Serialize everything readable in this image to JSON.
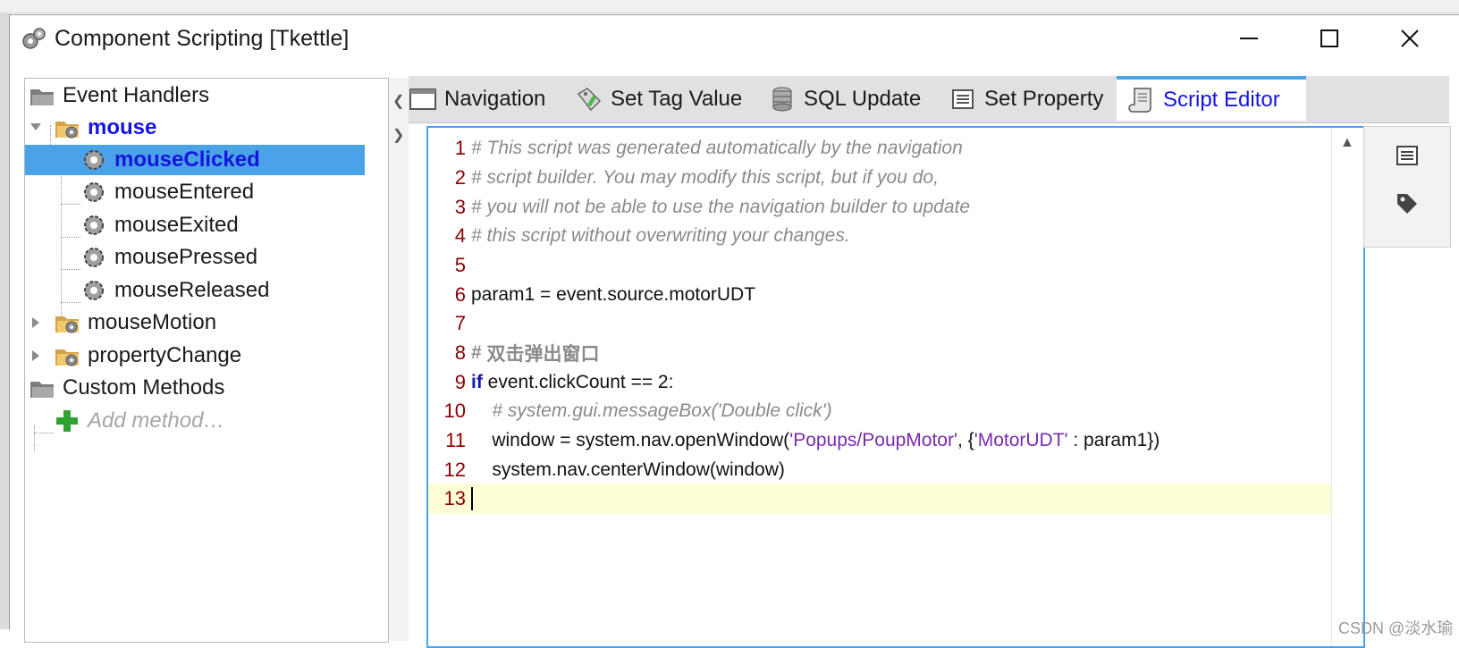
{
  "window": {
    "title": "Component Scripting [Tkettle]",
    "icons": [
      "gears-icon",
      "minimize-icon",
      "maximize-icon",
      "close-icon"
    ]
  },
  "tree": {
    "event_handlers": "Event Handlers",
    "mouse": "mouse",
    "items": [
      "mouseClicked",
      "mouseEntered",
      "mouseExited",
      "mousePressed",
      "mouseReleased"
    ],
    "mouse_motion": "mouseMotion",
    "property_change": "propertyChange",
    "custom_methods": "Custom Methods",
    "add_method": "Add method…",
    "selected": "mouseClicked"
  },
  "tabs": [
    {
      "label": "Navigation",
      "icon": "window-icon"
    },
    {
      "label": "Set Tag Value",
      "icon": "tag-edit-icon"
    },
    {
      "label": "SQL Update",
      "icon": "database-icon"
    },
    {
      "label": "Set Property",
      "icon": "list-icon"
    },
    {
      "label": "Script Editor",
      "icon": "script-icon",
      "active": true
    }
  ],
  "code": {
    "line_numbers": [
      "1",
      "2",
      "3",
      "4",
      "5",
      "6",
      "7",
      "8",
      "9",
      "10",
      "11",
      "12",
      "13"
    ],
    "l1": "# This script was generated automatically by the navigation",
    "l2": "# script builder. You may modify this script, but if you do,",
    "l3": "# you will not be able to use the navigation builder to update",
    "l4": "# this script without overwriting your changes.",
    "l6": "param1 = event.source.motorUDT",
    "l8_hash": "# ",
    "l8_zh": "双击弹出窗口",
    "l9_kw": "if",
    "l9_rest": " event.clickCount == 2:",
    "l10": "    # system.gui.messageBox('Double click')",
    "l11_a": "    window = system.nav.openWindow(",
    "l11_s1": "'Popups/PoupMotor'",
    "l11_b": ", {",
    "l11_s2": "'MotorUDT'",
    "l11_c": " : param1})",
    "l12": "    system.nav.centerWindow(window)"
  },
  "side_tools": [
    "list-icon",
    "tag-icon"
  ],
  "watermark": "CSDN @淡水瑜",
  "colors": {
    "accent": "#4aa3e6",
    "link": "#1515e0",
    "line_number": "#8a0000",
    "current_line": "#fdfdd6"
  }
}
